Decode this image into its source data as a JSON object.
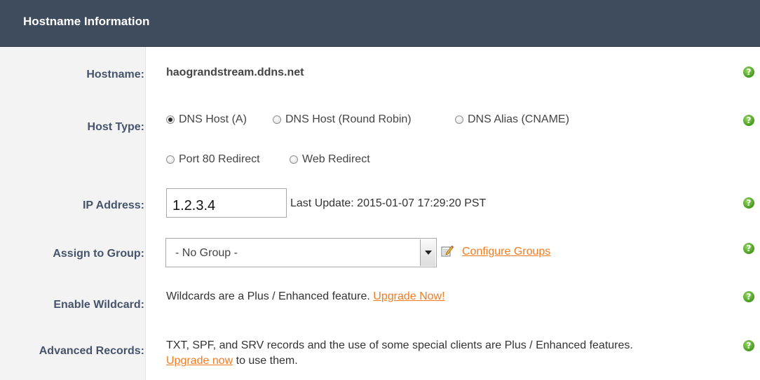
{
  "header": {
    "title": "Hostname Information"
  },
  "rows": {
    "hostname": {
      "label": "Hostname:",
      "value": "haograndstream.ddns.net"
    },
    "host_type": {
      "label": "Host Type:",
      "options": [
        {
          "label": "DNS Host (A)",
          "checked": true
        },
        {
          "label": "DNS Host (Round Robin)",
          "checked": false
        },
        {
          "label": "DNS Alias (CNAME)",
          "checked": false
        },
        {
          "label": "Port 80 Redirect",
          "checked": false
        },
        {
          "label": "Web Redirect",
          "checked": false
        }
      ]
    },
    "ip_address": {
      "label": "IP Address:",
      "value": "1.2.3.4",
      "last_update": "Last Update: 2015-01-07 17:29:20 PST"
    },
    "group": {
      "label": "Assign to Group:",
      "selected": "- No Group -",
      "configure_link": "Configure Groups"
    },
    "wildcard": {
      "label": "Enable Wildcard:",
      "text": "Wildcards are a Plus / Enhanced feature. ",
      "link": "Upgrade Now!"
    },
    "advanced": {
      "label": "Advanced Records:",
      "text_line1": "TXT, SPF, and SRV records and the use of some special clients are Plus / Enhanced features.",
      "link": "Upgrade now",
      "text_line2": " to use them."
    }
  },
  "help_icon_glyph": "?",
  "colors": {
    "header_bg": "#3f4c5d",
    "label_color": "#46536a",
    "link_color": "#f47b20",
    "help_green": "#4a9f1f"
  }
}
